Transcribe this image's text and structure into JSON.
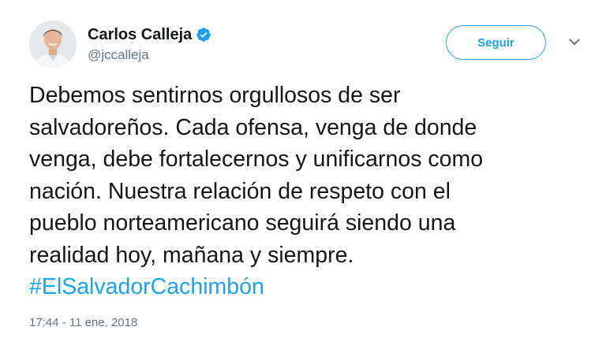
{
  "tweet": {
    "author": {
      "display_name": "Carlos Calleja",
      "handle": "@jccalleja",
      "verified": true
    },
    "follow_label": "Seguir",
    "text_lines": [
      "Debemos sentirnos orgullosos de ser",
      "salvadoreños. Cada ofensa, venga de donde",
      "venga, debe fortalecernos y unificarnos como",
      "nación. Nuestra relación de respeto con el",
      "pueblo norteamericano seguirá siendo una",
      "realidad hoy, mañana y siempre."
    ],
    "hashtag": "#ElSalvadorCachimbón",
    "timestamp": "17:44 - 11 ene. 2018"
  },
  "colors": {
    "accent": "#1da1f2",
    "text": "#14171a",
    "secondary_text": "#657786"
  },
  "icons": {
    "verified": "verified-badge-icon",
    "more": "chevron-down-icon"
  }
}
